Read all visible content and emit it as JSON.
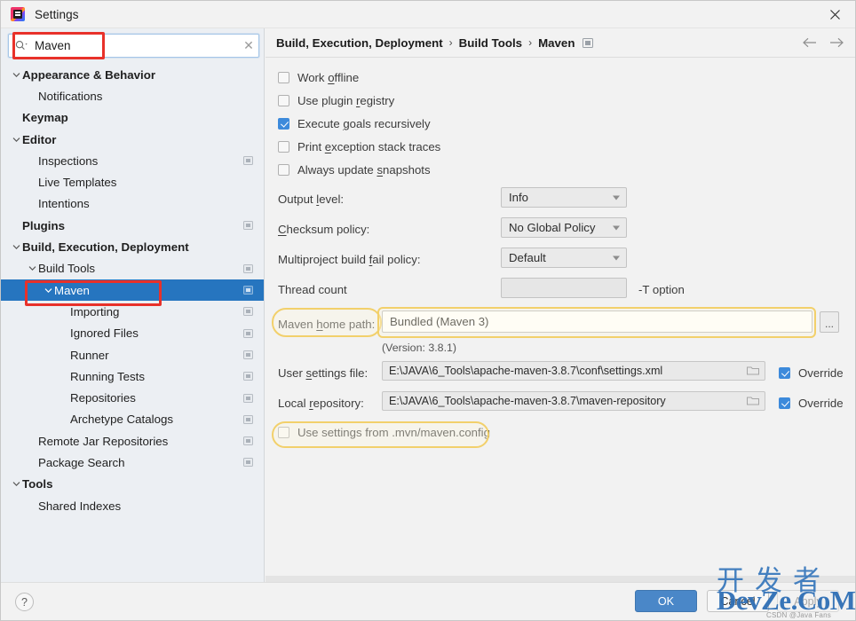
{
  "window": {
    "title": "Settings",
    "app_icon": "intellij-idea-icon",
    "close_icon": "close-icon"
  },
  "search": {
    "value": "Maven",
    "placeholder": "",
    "icon": "search-icon",
    "clear_icon": "close-icon"
  },
  "sidebar": {
    "items": [
      {
        "label": "Appearance & Behavior",
        "indent": 0,
        "bold": true,
        "arrow": "chevron-down",
        "badge": false,
        "selected": false,
        "name": "sidebar-item-appearance-behavior"
      },
      {
        "label": "Notifications",
        "indent": 1,
        "bold": false,
        "arrow": "",
        "badge": false,
        "selected": false,
        "name": "sidebar-item-notifications"
      },
      {
        "label": "Keymap",
        "indent": 0,
        "bold": true,
        "arrow": "",
        "badge": false,
        "selected": false,
        "name": "sidebar-item-keymap"
      },
      {
        "label": "Editor",
        "indent": 0,
        "bold": true,
        "arrow": "chevron-down",
        "badge": false,
        "selected": false,
        "name": "sidebar-item-editor"
      },
      {
        "label": "Inspections",
        "indent": 1,
        "bold": false,
        "arrow": "",
        "badge": true,
        "selected": false,
        "name": "sidebar-item-inspections"
      },
      {
        "label": "Live Templates",
        "indent": 1,
        "bold": false,
        "arrow": "",
        "badge": false,
        "selected": false,
        "name": "sidebar-item-live-templates"
      },
      {
        "label": "Intentions",
        "indent": 1,
        "bold": false,
        "arrow": "",
        "badge": false,
        "selected": false,
        "name": "sidebar-item-intentions"
      },
      {
        "label": "Plugins",
        "indent": 0,
        "bold": true,
        "arrow": "",
        "badge": true,
        "selected": false,
        "name": "sidebar-item-plugins"
      },
      {
        "label": "Build, Execution, Deployment",
        "indent": 0,
        "bold": true,
        "arrow": "chevron-down",
        "badge": false,
        "selected": false,
        "name": "sidebar-item-build-execution-deployment"
      },
      {
        "label": "Build Tools",
        "indent": 1,
        "bold": false,
        "arrow": "chevron-down",
        "badge": true,
        "selected": false,
        "name": "sidebar-item-build-tools"
      },
      {
        "label": "Maven",
        "indent": 2,
        "bold": false,
        "arrow": "chevron-down",
        "badge": true,
        "selected": true,
        "name": "sidebar-item-maven"
      },
      {
        "label": "Importing",
        "indent": 3,
        "bold": false,
        "arrow": "",
        "badge": true,
        "selected": false,
        "name": "sidebar-item-importing"
      },
      {
        "label": "Ignored Files",
        "indent": 3,
        "bold": false,
        "arrow": "",
        "badge": true,
        "selected": false,
        "name": "sidebar-item-ignored-files"
      },
      {
        "label": "Runner",
        "indent": 3,
        "bold": false,
        "arrow": "",
        "badge": true,
        "selected": false,
        "name": "sidebar-item-runner"
      },
      {
        "label": "Running Tests",
        "indent": 3,
        "bold": false,
        "arrow": "",
        "badge": true,
        "selected": false,
        "name": "sidebar-item-running-tests"
      },
      {
        "label": "Repositories",
        "indent": 3,
        "bold": false,
        "arrow": "",
        "badge": true,
        "selected": false,
        "name": "sidebar-item-repositories"
      },
      {
        "label": "Archetype Catalogs",
        "indent": 3,
        "bold": false,
        "arrow": "",
        "badge": true,
        "selected": false,
        "name": "sidebar-item-archetype-catalogs"
      },
      {
        "label": "Remote Jar Repositories",
        "indent": 1,
        "bold": false,
        "arrow": "",
        "badge": true,
        "selected": false,
        "name": "sidebar-item-remote-jar-repositories"
      },
      {
        "label": "Package Search",
        "indent": 1,
        "bold": false,
        "arrow": "",
        "badge": true,
        "selected": false,
        "name": "sidebar-item-package-search"
      },
      {
        "label": "Tools",
        "indent": 0,
        "bold": true,
        "arrow": "chevron-down",
        "badge": false,
        "selected": false,
        "name": "sidebar-item-tools"
      },
      {
        "label": "Shared Indexes",
        "indent": 1,
        "bold": false,
        "arrow": "",
        "badge": false,
        "selected": false,
        "name": "sidebar-item-shared-indexes"
      }
    ]
  },
  "breadcrumb": {
    "parts": [
      "Build, Execution, Deployment",
      "Build Tools",
      "Maven"
    ],
    "separator": "›",
    "badge_icon": "project-scope-icon",
    "back_icon": "arrow-left-icon",
    "forward_icon": "arrow-right-icon"
  },
  "main": {
    "checkboxes": [
      {
        "label": "Work offline",
        "checked": false,
        "name": "checkbox-work-offline"
      },
      {
        "label": "Use plugin registry",
        "checked": false,
        "name": "checkbox-use-plugin-registry"
      },
      {
        "label": "Execute goals recursively",
        "checked": true,
        "name": "checkbox-execute-goals-recursively"
      },
      {
        "label": "Print exception stack traces",
        "checked": false,
        "name": "checkbox-print-exception-stack-traces"
      },
      {
        "label": "Always update snapshots",
        "checked": false,
        "name": "checkbox-always-update-snapshots"
      }
    ],
    "output_level": {
      "label": "Output level:",
      "value": "Info"
    },
    "checksum_policy": {
      "label": "Checksum policy:",
      "value": "No Global Policy"
    },
    "multiproject_fail_policy": {
      "label": "Multiproject build fail policy:",
      "value": "Default"
    },
    "thread_count": {
      "label": "Thread count",
      "value": "",
      "hint": "-T option"
    },
    "maven_home_path": {
      "label": "Maven home path:",
      "value": "Bundled (Maven 3)",
      "version_note": "(Version: 3.8.1)",
      "browse_label": "..."
    },
    "user_settings_file": {
      "label": "User settings file:",
      "value": "E:\\JAVA\\6_Tools\\apache-maven-3.8.7\\conf\\settings.xml",
      "override_label": "Override",
      "override_checked": true
    },
    "local_repository": {
      "label": "Local repository:",
      "value": "E:\\JAVA\\6_Tools\\apache-maven-3.8.7\\maven-repository",
      "override_label": "Override",
      "override_checked": true
    },
    "use_mvn_config": {
      "label": "Use settings from .mvn/maven.config",
      "checked": false
    }
  },
  "footer": {
    "help_label": "?",
    "ok_label": "OK",
    "cancel_label": "Cancel",
    "apply_label": "Apply"
  },
  "watermark": {
    "cn": "开发者",
    "en": "DevZe.CoM",
    "credit": "CSDN @Java Fans"
  },
  "colors": {
    "selection_blue": "#2675bf",
    "accent_blue": "#3d8adb",
    "ok_button": "#4a87c8",
    "annotation_red": "#e8312a",
    "annotation_gold": "#f2d06b",
    "watermark_blue": "#2f6fb5"
  }
}
